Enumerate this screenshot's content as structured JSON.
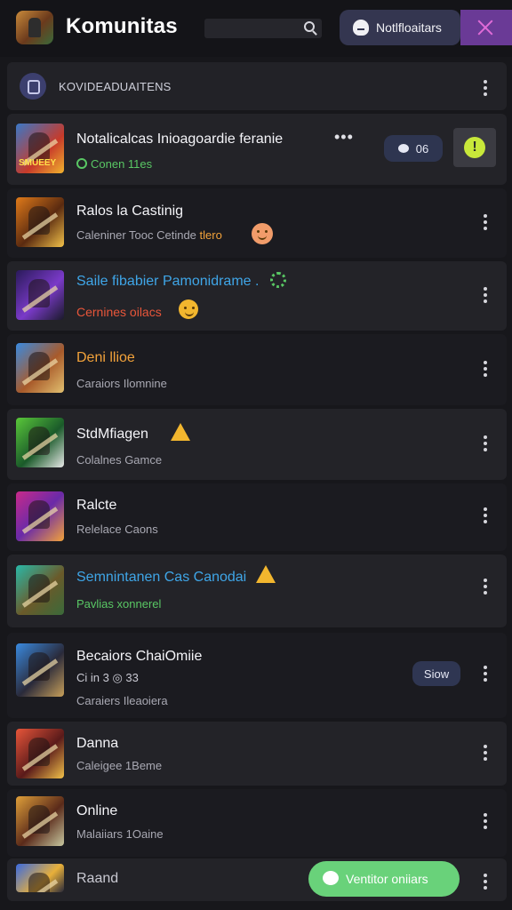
{
  "header": {
    "title": "Komunitas",
    "notifications_label": "Notlfloaitars"
  },
  "section": {
    "label": "KOVIDEADUAITENS"
  },
  "rows": [
    {
      "title": "Notalicalcas Inioagoardie feranie",
      "subtitle": "Conen 11es",
      "thumb_label": "SMUEEY",
      "badge": "06"
    },
    {
      "title": "Ralos la Castinig",
      "subtitle_prefix": "Caleniner Tooc Cetinde",
      "subtitle_highlight": "tlero"
    },
    {
      "title": "Saile fibabier Pamonidrame .",
      "subtitle": "Cernines oilacs"
    },
    {
      "title": "Deni llioe",
      "subtitle": "Caraiors Ilomnine"
    },
    {
      "title": "StdMfiagen",
      "subtitle": "Colalnes Gamce"
    },
    {
      "title": "Ralcte",
      "subtitle": "Relelace Caons"
    },
    {
      "title": "Semnintanen Cas Canodai",
      "subtitle": "Pavlias xonnerel"
    },
    {
      "title": "Becaiors ChaiOmiie",
      "stats": "Ci in 3 ◎ 33",
      "subtitle": "Caraiers Ileaoiera",
      "action": "Siow"
    },
    {
      "title": "Danna",
      "subtitle": "Caleigee 1Beme"
    },
    {
      "title": "Online",
      "subtitle": "Malaiiars 1Oaine"
    },
    {
      "title": "Raand"
    }
  ],
  "fab": {
    "label": "Ventitor oniiars"
  },
  "colors": {
    "background": "#17171b",
    "accent_purple": "#6a3a96",
    "accent_green": "#69d27a",
    "highlight_blue": "#3fa6e8",
    "highlight_orange": "#f2a23a",
    "highlight_red": "#e8563a",
    "highlight_green": "#59c764"
  }
}
